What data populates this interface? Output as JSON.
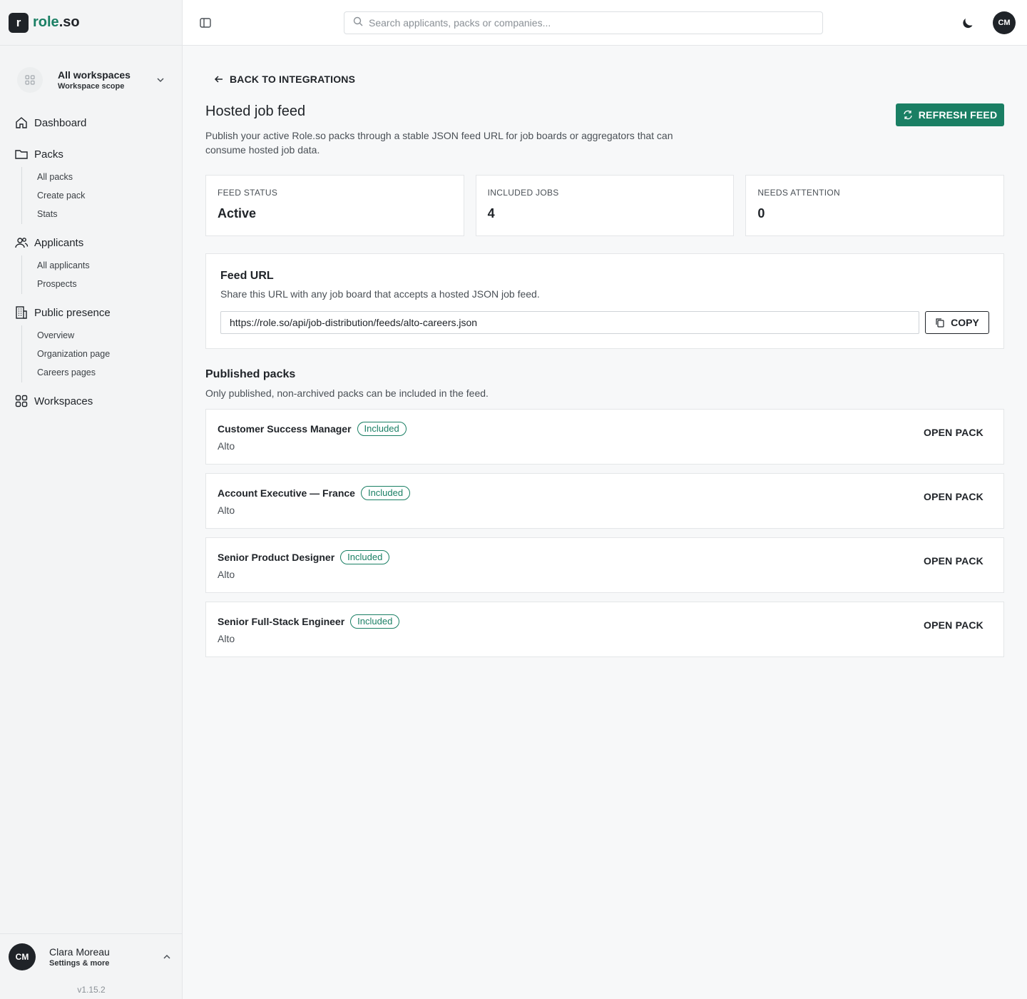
{
  "brand": {
    "mark": "r",
    "name_prefix": "role",
    "name_suffix": ".so"
  },
  "scope": {
    "title": "All workspaces",
    "subtitle": "Workspace scope"
  },
  "nav": {
    "dashboard": "Dashboard",
    "packs": {
      "label": "Packs",
      "items": [
        "All packs",
        "Create pack",
        "Stats"
      ]
    },
    "applicants": {
      "label": "Applicants",
      "items": [
        "All applicants",
        "Prospects"
      ]
    },
    "public_presence": {
      "label": "Public presence",
      "items": [
        "Overview",
        "Organization page",
        "Careers pages"
      ]
    },
    "workspaces": "Workspaces"
  },
  "user": {
    "initials": "CM",
    "name": "Clara Moreau",
    "subtitle": "Settings & more"
  },
  "version": "v1.15.2",
  "topbar": {
    "search_placeholder": "Search applicants, packs or companies...",
    "avatar_initials": "CM"
  },
  "page": {
    "back_label": "BACK TO INTEGRATIONS",
    "title": "Hosted job feed",
    "description": "Publish your active Role.so packs through a stable JSON feed URL for job boards or aggregators that can consume hosted job data.",
    "refresh_label": "REFRESH FEED"
  },
  "stats": [
    {
      "label": "FEED STATUS",
      "value": "Active"
    },
    {
      "label": "INCLUDED JOBS",
      "value": "4"
    },
    {
      "label": "NEEDS ATTENTION",
      "value": "0"
    }
  ],
  "feed_url": {
    "title": "Feed URL",
    "subtitle": "Share this URL with any job board that accepts a hosted JSON job feed.",
    "value": "https://role.so/api/job-distribution/feeds/alto-careers.json",
    "copy_label": "COPY"
  },
  "published": {
    "title": "Published packs",
    "subtitle": "Only published, non-archived packs can be included in the feed.",
    "open_label": "OPEN PACK",
    "packs": [
      {
        "title": "Customer Success Manager",
        "badge": "Included",
        "company": "Alto"
      },
      {
        "title": "Account Executive — France",
        "badge": "Included",
        "company": "Alto"
      },
      {
        "title": "Senior Product Designer",
        "badge": "Included",
        "company": "Alto"
      },
      {
        "title": "Senior Full-Stack Engineer",
        "badge": "Included",
        "company": "Alto"
      }
    ]
  },
  "colors": {
    "accent": "#1a7f64",
    "dark": "#1f2328",
    "border": "#e4e6e8"
  }
}
